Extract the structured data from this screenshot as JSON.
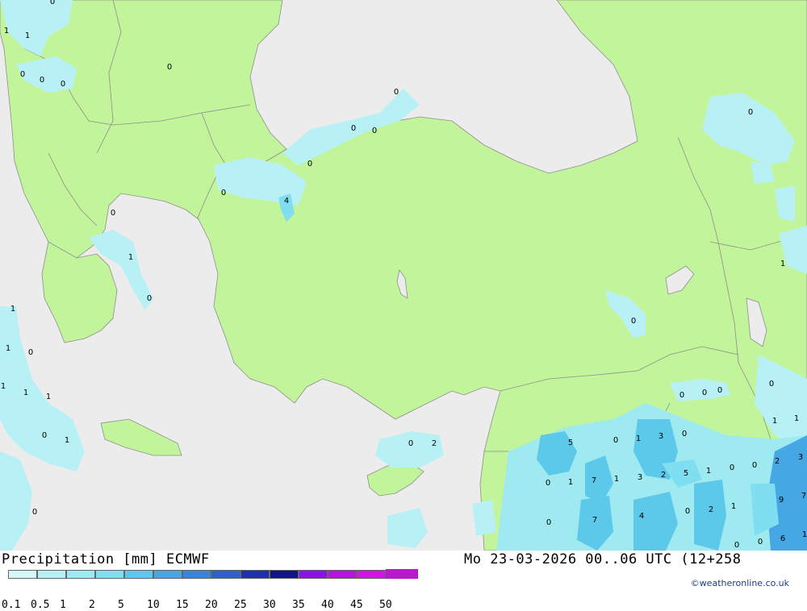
{
  "header": {
    "title": "Precipitation [mm] ECMWF",
    "datetime": "Mo 23-03-2026 00..06 UTC (12+258"
  },
  "legend": {
    "ticks": [
      "0.1",
      "0.5",
      "1",
      "2",
      "5",
      "10",
      "15",
      "20",
      "25",
      "30",
      "35",
      "40",
      "45",
      "50"
    ],
    "colors": [
      "#d7f8fa",
      "#b8f1f5",
      "#9eeaf0",
      "#7fdff0",
      "#5cc8ea",
      "#45a8e4",
      "#3b82dc",
      "#2f5fcf",
      "#1f2fb0",
      "#12128a",
      "#8a14e8",
      "#b814e0",
      "#d414e6",
      "#b81acb"
    ]
  },
  "credit": "©weatheronline.co.uk",
  "colors": {
    "land": "#c2f59b",
    "sea": "#ececec",
    "border": "#8e8e8e"
  },
  "map_labels": [
    {
      "t": "0"
    },
    {
      "t": "1"
    },
    {
      "t": "1"
    },
    {
      "t": "0"
    },
    {
      "t": "0"
    },
    {
      "t": "0"
    },
    {
      "t": "0"
    },
    {
      "t": "0"
    },
    {
      "t": "0"
    },
    {
      "t": "0"
    },
    {
      "t": "0"
    },
    {
      "t": "0"
    },
    {
      "t": "4"
    },
    {
      "t": "0"
    },
    {
      "t": "1"
    },
    {
      "t": "0"
    },
    {
      "t": "1"
    },
    {
      "t": "1"
    },
    {
      "t": "0"
    },
    {
      "t": "1"
    },
    {
      "t": "1"
    },
    {
      "t": "1"
    },
    {
      "t": "0"
    },
    {
      "t": "1"
    },
    {
      "t": "0"
    },
    {
      "t": "0"
    },
    {
      "t": "2"
    },
    {
      "t": "0"
    },
    {
      "t": "1"
    },
    {
      "t": "0"
    },
    {
      "t": "0"
    },
    {
      "t": "0"
    },
    {
      "t": "0"
    },
    {
      "t": "0"
    },
    {
      "t": "1"
    },
    {
      "t": "1"
    },
    {
      "t": "5"
    },
    {
      "t": "0"
    },
    {
      "t": "1"
    },
    {
      "t": "3"
    },
    {
      "t": "0"
    },
    {
      "t": "0"
    },
    {
      "t": "1"
    },
    {
      "t": "7"
    },
    {
      "t": "1"
    },
    {
      "t": "3"
    },
    {
      "t": "2"
    },
    {
      "t": "5"
    },
    {
      "t": "1"
    },
    {
      "t": "0"
    },
    {
      "t": "0"
    },
    {
      "t": "2"
    },
    {
      "t": "3"
    },
    {
      "t": "0"
    },
    {
      "t": "7"
    },
    {
      "t": "4"
    },
    {
      "t": "0"
    },
    {
      "t": "2"
    },
    {
      "t": "1"
    },
    {
      "t": "9"
    },
    {
      "t": "7"
    },
    {
      "t": "0"
    },
    {
      "t": "0"
    },
    {
      "t": "6"
    },
    {
      "t": "1"
    }
  ]
}
